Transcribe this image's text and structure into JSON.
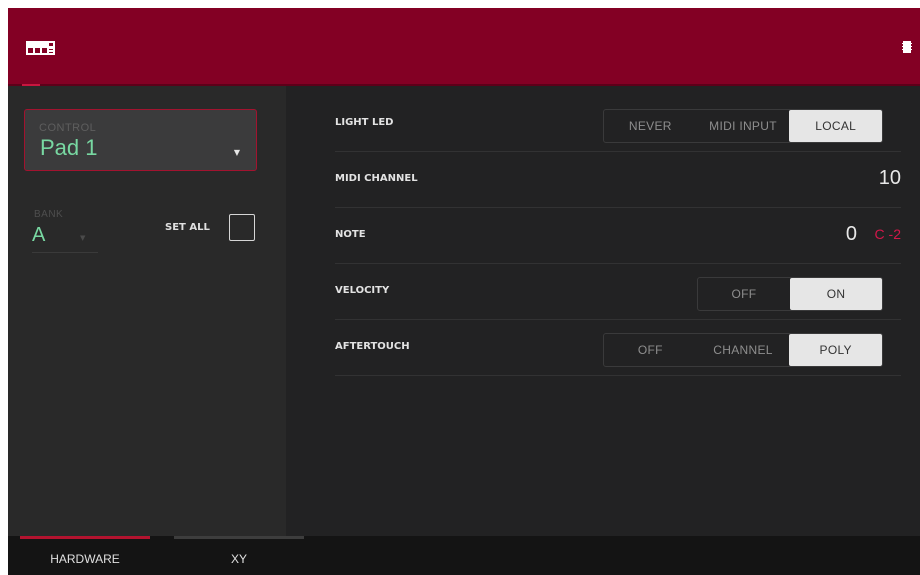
{
  "colors": {
    "header": "#830024",
    "accent_red": "#a2132f",
    "green_value": "#78d8a2",
    "note_red": "#d3174a",
    "selected_segment": "#e6e6e6"
  },
  "header": {
    "left_icon": "pad-grid-icon",
    "right_icon": "chip-icon"
  },
  "sidebar": {
    "control_label": "CONTROL",
    "control_value": "Pad 1",
    "bank_label": "BANK",
    "bank_value": "A",
    "set_all_label": "SET ALL",
    "set_all_checked": false
  },
  "settings": {
    "light_led": {
      "label": "LIGHT LED",
      "options": [
        "NEVER",
        "MIDI INPUT",
        "LOCAL"
      ],
      "selected": "LOCAL"
    },
    "midi_channel": {
      "label": "MIDI CHANNEL",
      "value": "10"
    },
    "note": {
      "label": "NOTE",
      "value": "0",
      "note_name": "C -2"
    },
    "velocity": {
      "label": "VELOCITY",
      "options": [
        "OFF",
        "ON"
      ],
      "selected": "ON"
    },
    "aftertouch": {
      "label": "AFTERTOUCH",
      "options": [
        "OFF",
        "CHANNEL",
        "POLY"
      ],
      "selected": "POLY"
    }
  },
  "tabs": [
    {
      "label": "HARDWARE",
      "active": true
    },
    {
      "label": "XY",
      "active": false
    }
  ]
}
